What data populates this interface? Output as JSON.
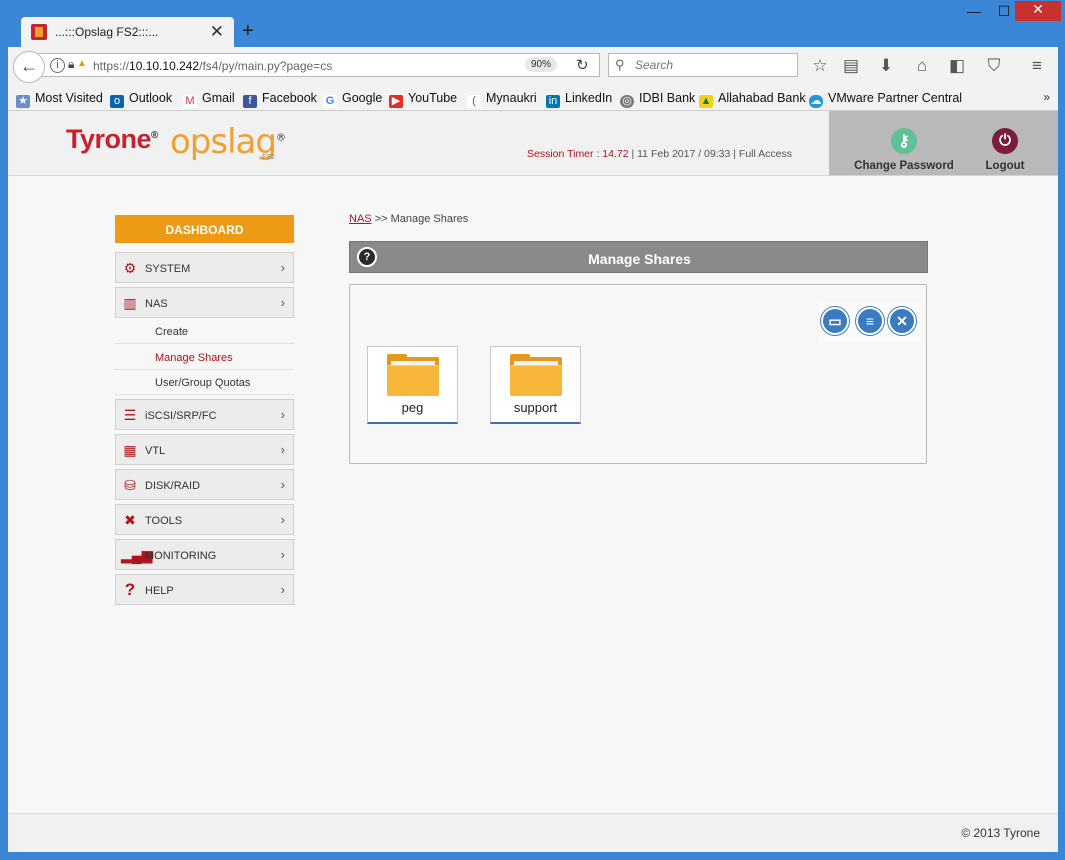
{
  "browser": {
    "tab_title": "...:::Opslag FS2:::...",
    "url_prefix": "https://",
    "url_host": "10.10.10.242",
    "url_path": "/fs4/py/main.py?page=cs",
    "zoom": "90%",
    "search_placeholder": "Search"
  },
  "bookmarks": [
    {
      "label": "Most Visited"
    },
    {
      "label": "Outlook"
    },
    {
      "label": "Gmail"
    },
    {
      "label": "Facebook"
    },
    {
      "label": "Google"
    },
    {
      "label": "YouTube"
    },
    {
      "label": "Mynaukri"
    },
    {
      "label": "LinkedIn"
    },
    {
      "label": "IDBI Bank"
    },
    {
      "label": "Allahabad Bank"
    },
    {
      "label": "VMware Partner Central"
    }
  ],
  "header": {
    "brand": "Tyrone",
    "product": "opslag",
    "product_sub": "FS2",
    "session_label": "Session Timer : 14.72",
    "session_rest": " | 11 Feb 2017 / 09:33 | Full Access",
    "change_password": "Change Password",
    "logout": "Logout"
  },
  "sidebar": {
    "dashboard": "DASHBOARD",
    "system": "SYSTEM",
    "nas": "NAS",
    "nas_sub": [
      "Create",
      "Manage Shares",
      "User/Group Quotas"
    ],
    "iscsi": "iSCSI/SRP/FC",
    "vtl": "VTL",
    "disk": "DISK/RAID",
    "tools": "TOOLS",
    "monitoring": "MONITORING",
    "help": "HELP"
  },
  "content": {
    "breadcrumb_link": "NAS",
    "breadcrumb_rest": ">> Manage Shares",
    "title": "Manage Shares",
    "shares": [
      "peg",
      "support"
    ]
  },
  "footer": "© 2013 Tyrone",
  "colors": {
    "accent_orange": "#ec9a14",
    "brand_red": "#c8232c",
    "action_blue": "#3b7cc0"
  }
}
